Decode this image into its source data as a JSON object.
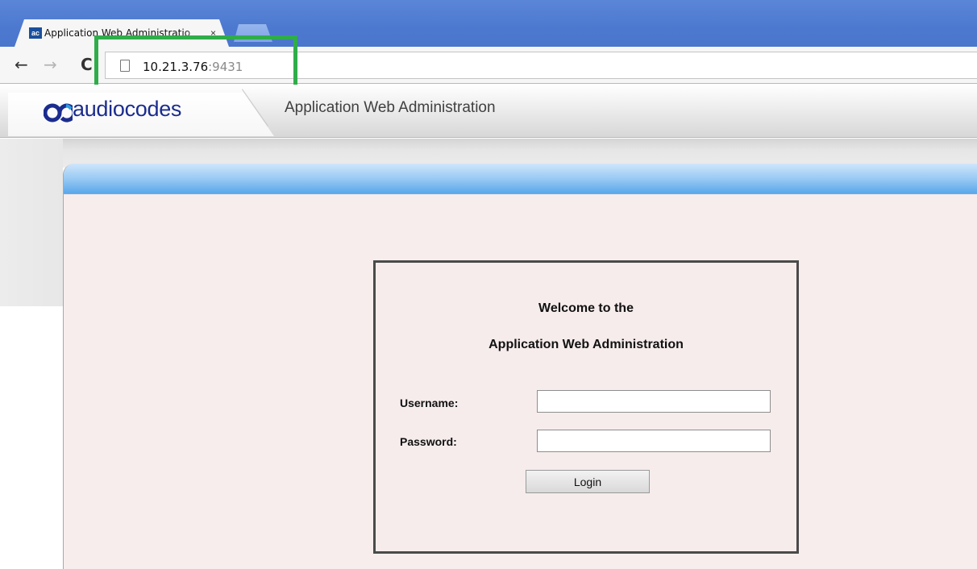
{
  "browser": {
    "tab": {
      "title": "Application Web Administratio",
      "favicon": "audiocodes-favicon",
      "close": "×"
    },
    "nav": {
      "back": "←",
      "forward": "→",
      "reload": "C"
    },
    "address": {
      "host": "10.21.3.76",
      "port": ":9431"
    },
    "highlight_color": "#2fad4a"
  },
  "header": {
    "brand": "audiocodes",
    "app_title": "Application Web Administration",
    "brand_color": "#1b2c8e"
  },
  "login": {
    "welcome_line1": "Welcome to the",
    "welcome_line2": "Application Web Administration",
    "username_label": "Username:",
    "password_label": "Password:",
    "username_value": "",
    "password_value": "",
    "login_button": "Login"
  }
}
